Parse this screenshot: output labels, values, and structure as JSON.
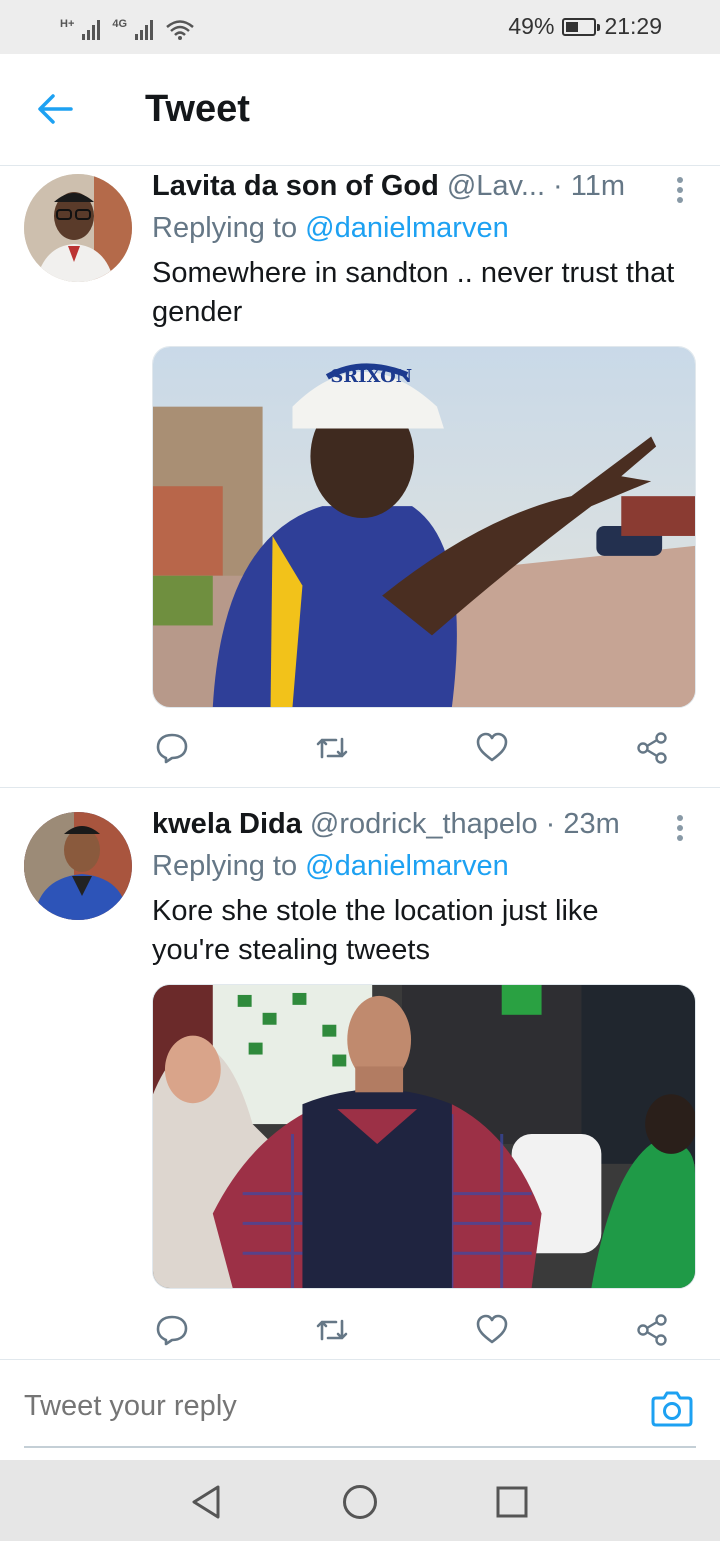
{
  "status_bar": {
    "network1": "H+",
    "network2": "4G",
    "battery": "49%",
    "time": "21:29"
  },
  "header": {
    "title": "Tweet",
    "back_icon": "arrow-left-icon",
    "accent": "#1da1f2"
  },
  "tweets": [
    {
      "name": "Lavita da son of God",
      "handle": "@Lav...",
      "time": "· 11m",
      "replying_prefix": "Replying to",
      "replying_to": "@danielmarven",
      "text": "Somewhere in sandton .. never trust that gender",
      "media": {
        "cap_text": "SRIXON"
      },
      "actions": [
        "reply-icon",
        "retweet-icon",
        "like-icon",
        "share-icon"
      ]
    },
    {
      "name": "kwela Dida",
      "handle": "@rodrick_thapelo",
      "time": "· 23m",
      "replying_prefix": "Replying to",
      "replying_to": "@danielmarven",
      "text": "Kore she stole the location just like you're stealing tweets",
      "actions": [
        "reply-icon",
        "retweet-icon",
        "like-icon",
        "share-icon"
      ]
    }
  ],
  "composer": {
    "placeholder": "Tweet your reply",
    "camera_icon": "camera-icon"
  },
  "navbar": {
    "buttons": [
      "back-triangle-icon",
      "home-circle-icon",
      "recents-square-icon"
    ]
  }
}
